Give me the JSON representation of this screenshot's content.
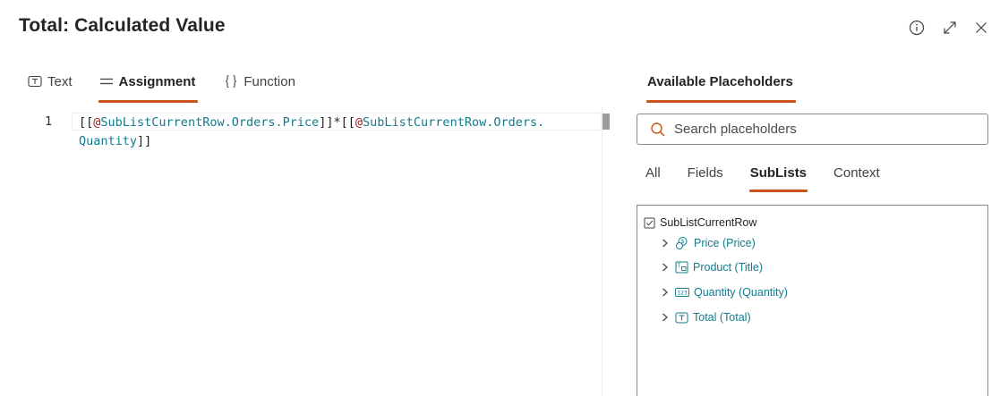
{
  "header": {
    "title": "Total: Calculated Value",
    "info_icon": "info-icon",
    "expand_icon": "expand-icon",
    "close_icon": "close-icon"
  },
  "mode_tabs": [
    {
      "label": "Text",
      "icon": "text-icon",
      "active": false
    },
    {
      "label": "Assignment",
      "icon": "lines-icon",
      "active": true
    },
    {
      "label": "Function",
      "icon": "braces-icon",
      "active": false
    }
  ],
  "editor": {
    "line_number": "1",
    "code_parts": {
      "open1": "[[",
      "at1": "@",
      "ref1": "SubListCurrentRow.Orders.Price",
      "mid": "]]*[[",
      "at2": "@",
      "ref2a": "SubListCurrentRow.Orders.",
      "ref2b": "Quantity",
      "close2": "]]"
    }
  },
  "placeholders": {
    "panel_title": "Available Placeholders",
    "search_placeholder": "Search placeholders",
    "filter_tabs": [
      {
        "label": "All",
        "active": false
      },
      {
        "label": "Fields",
        "active": false
      },
      {
        "label": "SubLists",
        "active": true
      },
      {
        "label": "Context",
        "active": false
      }
    ],
    "tree": {
      "root_label": "SubListCurrentRow",
      "root_icon": "checkbox-icon",
      "items": [
        {
          "label": "Price (Price)",
          "icon": "currency-icon"
        },
        {
          "label": "Product (Title)",
          "icon": "text-field-icon"
        },
        {
          "label": "Quantity (Quantity)",
          "icon": "number-icon"
        },
        {
          "label": "Total (Total)",
          "icon": "text-icon"
        }
      ]
    }
  },
  "colors": {
    "accent": "#c8541b",
    "placeholder_text": "#127b8c",
    "at_sign": "#a31515"
  }
}
